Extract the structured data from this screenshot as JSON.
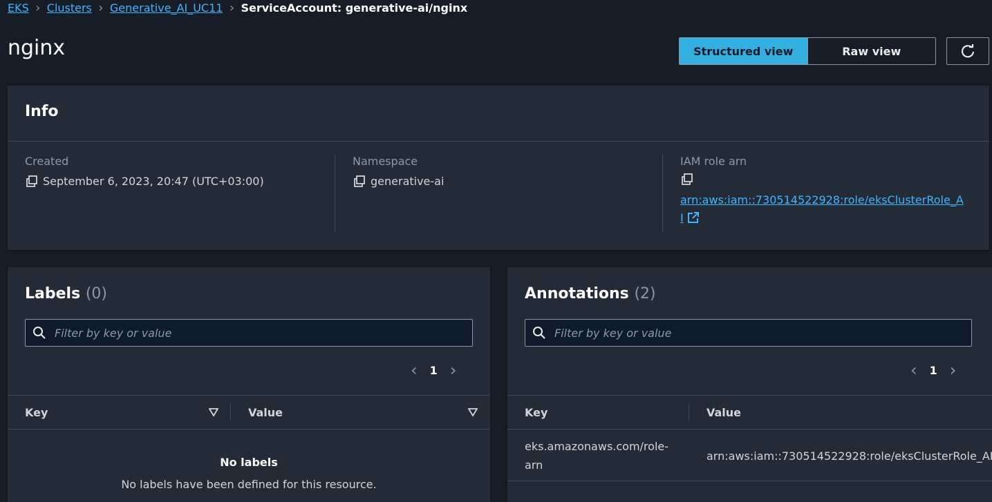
{
  "breadcrumb": {
    "items": [
      "EKS",
      "Clusters",
      "Generative_AI_UC11"
    ],
    "current": "ServiceAccount: generative-ai/nginx"
  },
  "page_title": "nginx",
  "view_toggle": {
    "structured": "Structured view",
    "raw": "Raw view",
    "selected": "Structured view"
  },
  "info": {
    "title": "Info",
    "created_label": "Created",
    "created_value": "September 6, 2023, 20:47 (UTC+03:00)",
    "namespace_label": "Namespace",
    "namespace_value": "generative-ai",
    "iam_label": "IAM role arn",
    "iam_line1": "arn:aws:iam::730514522928:role/eksClusterRole_A",
    "iam_line2": "I"
  },
  "labels": {
    "title": "Labels",
    "count": "(0)",
    "search_placeholder": "Filter by key or value",
    "page": "1",
    "col_key": "Key",
    "col_value": "Value",
    "empty_title": "No labels",
    "empty_desc": "No labels have been defined for this resource."
  },
  "annotations": {
    "title": "Annotations",
    "count": "(2)",
    "search_placeholder": "Filter by key or value",
    "page": "1",
    "col_key": "Key",
    "col_value": "Value",
    "rows": [
      {
        "key_line1": "eks.amazonaws.com/role-",
        "key_line2": "arn",
        "value": "arn:aws:iam::730514522928:role/eksClusterRole_AI"
      }
    ]
  },
  "colors": {
    "accent": "#33b0e0",
    "link": "#42b4ff",
    "background": "#161d26",
    "panel": "#232b37"
  }
}
